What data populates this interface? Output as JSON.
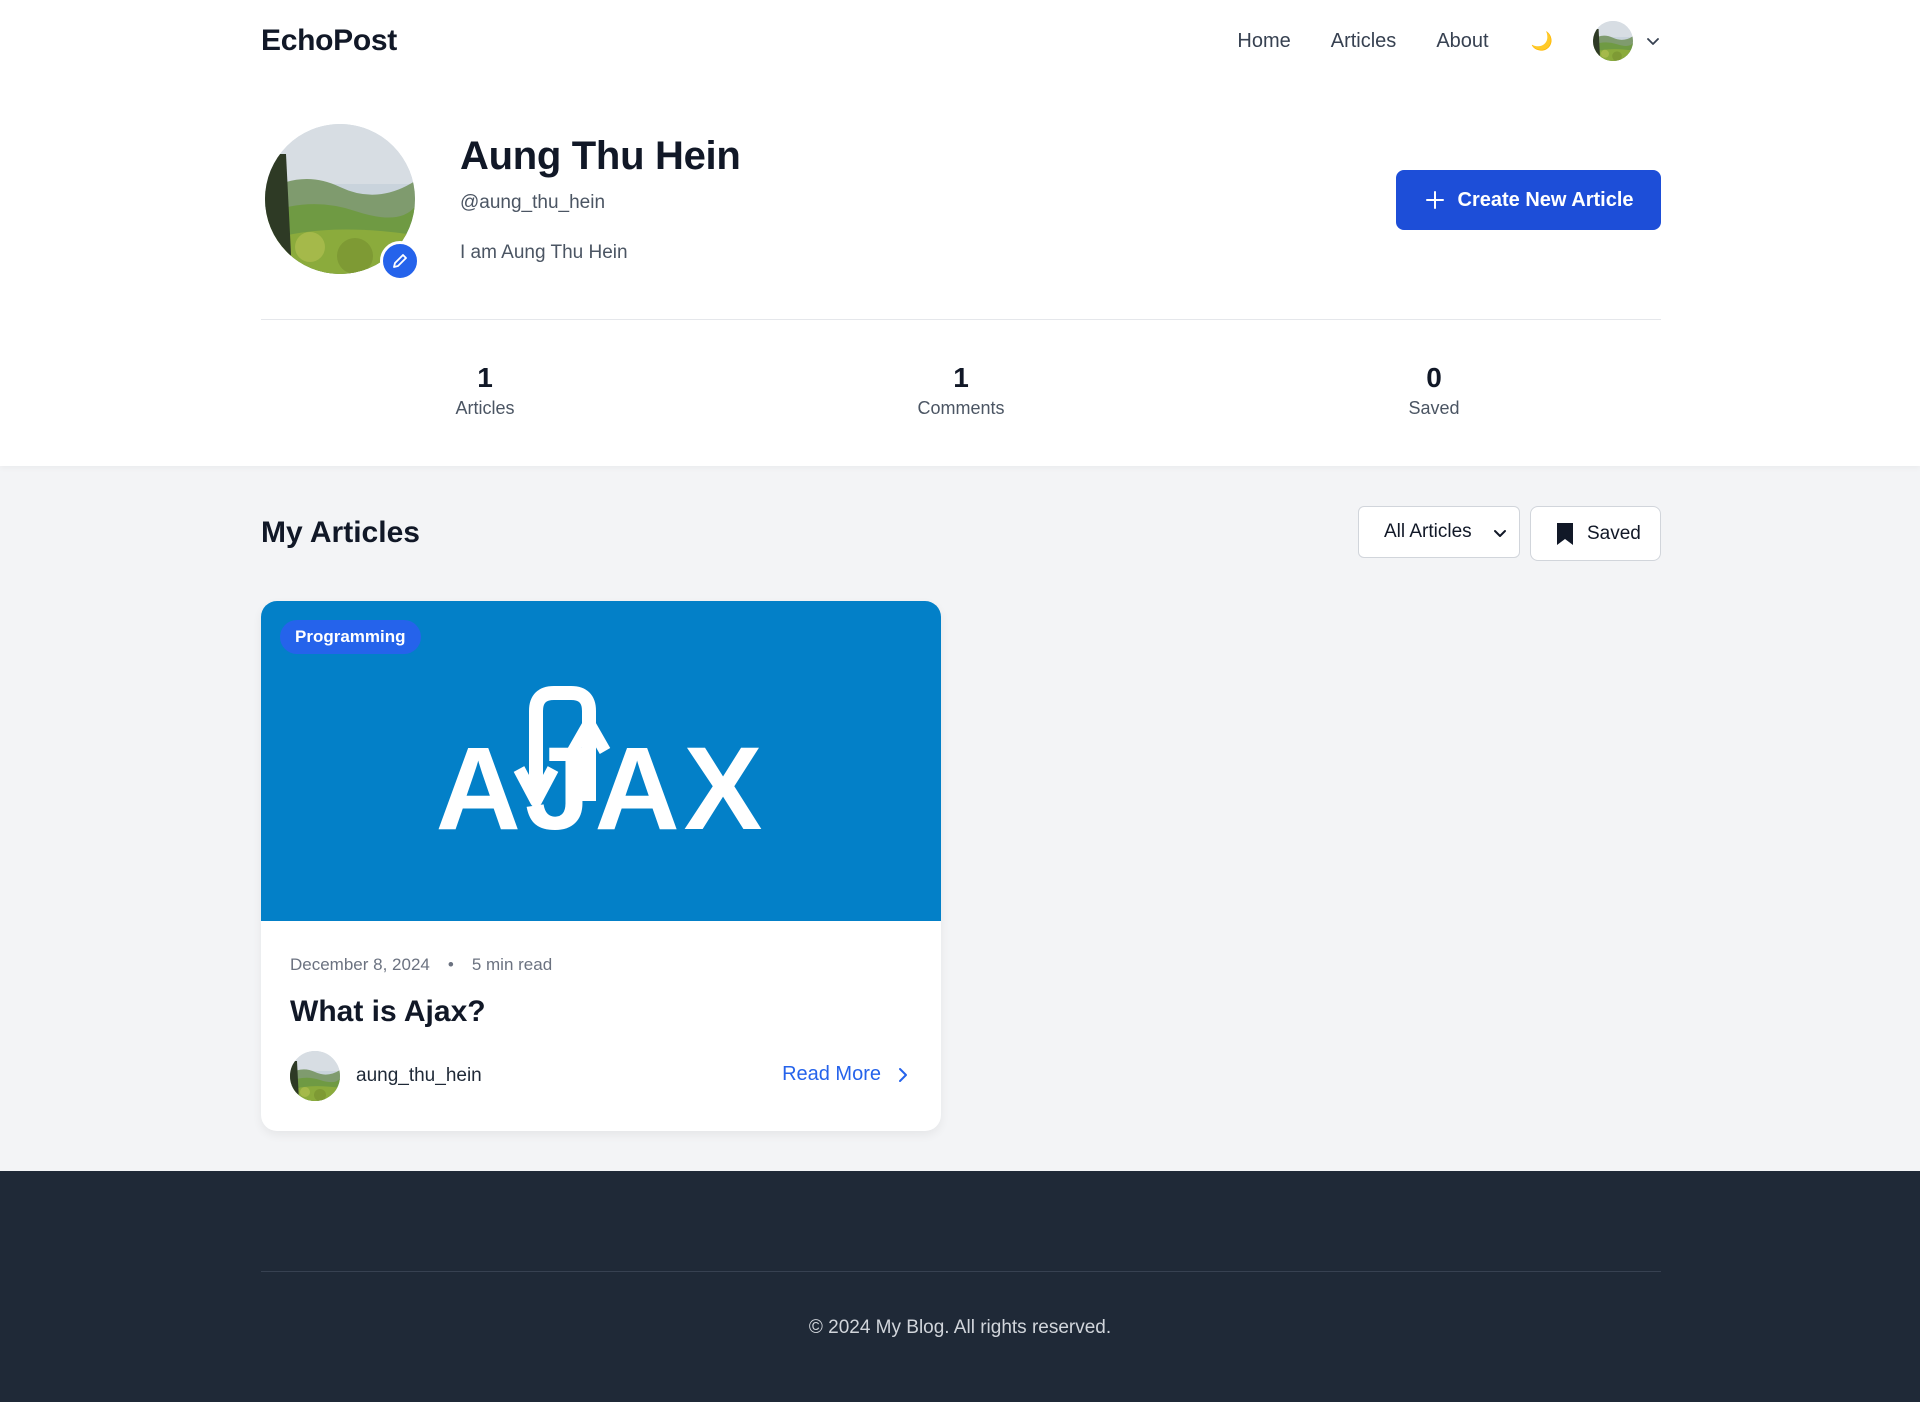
{
  "brand": "EchoPost",
  "nav": {
    "links": [
      "Home",
      "Articles",
      "About"
    ],
    "theme_icon": "moon-icon",
    "theme_glyph": "🌙"
  },
  "profile": {
    "name": "Aung Thu Hein",
    "handle": "@aung_thu_hein",
    "bio": "I am Aung Thu Hein",
    "create_button": "Create New Article"
  },
  "stats": [
    {
      "value": "1",
      "label": "Articles"
    },
    {
      "value": "1",
      "label": "Comments"
    },
    {
      "value": "0",
      "label": "Saved"
    }
  ],
  "my_articles": {
    "title": "My Articles",
    "filter_selected": "All Articles",
    "saved_button": "Saved"
  },
  "articles": [
    {
      "category": "Programming",
      "date": "December 8, 2024",
      "separator": "•",
      "read_time": "5 min read",
      "title": "What is Ajax?",
      "author": "aung_thu_hein",
      "read_more": "Read More",
      "image_text": "AJAX"
    }
  ],
  "footer": {
    "copyright": "© 2024 My Blog. All rights reserved."
  },
  "colors": {
    "accent": "#1d4ed8",
    "tag": "#2563eb",
    "card_image_bg": "#0380c8",
    "footer_bg": "#1f2937"
  }
}
